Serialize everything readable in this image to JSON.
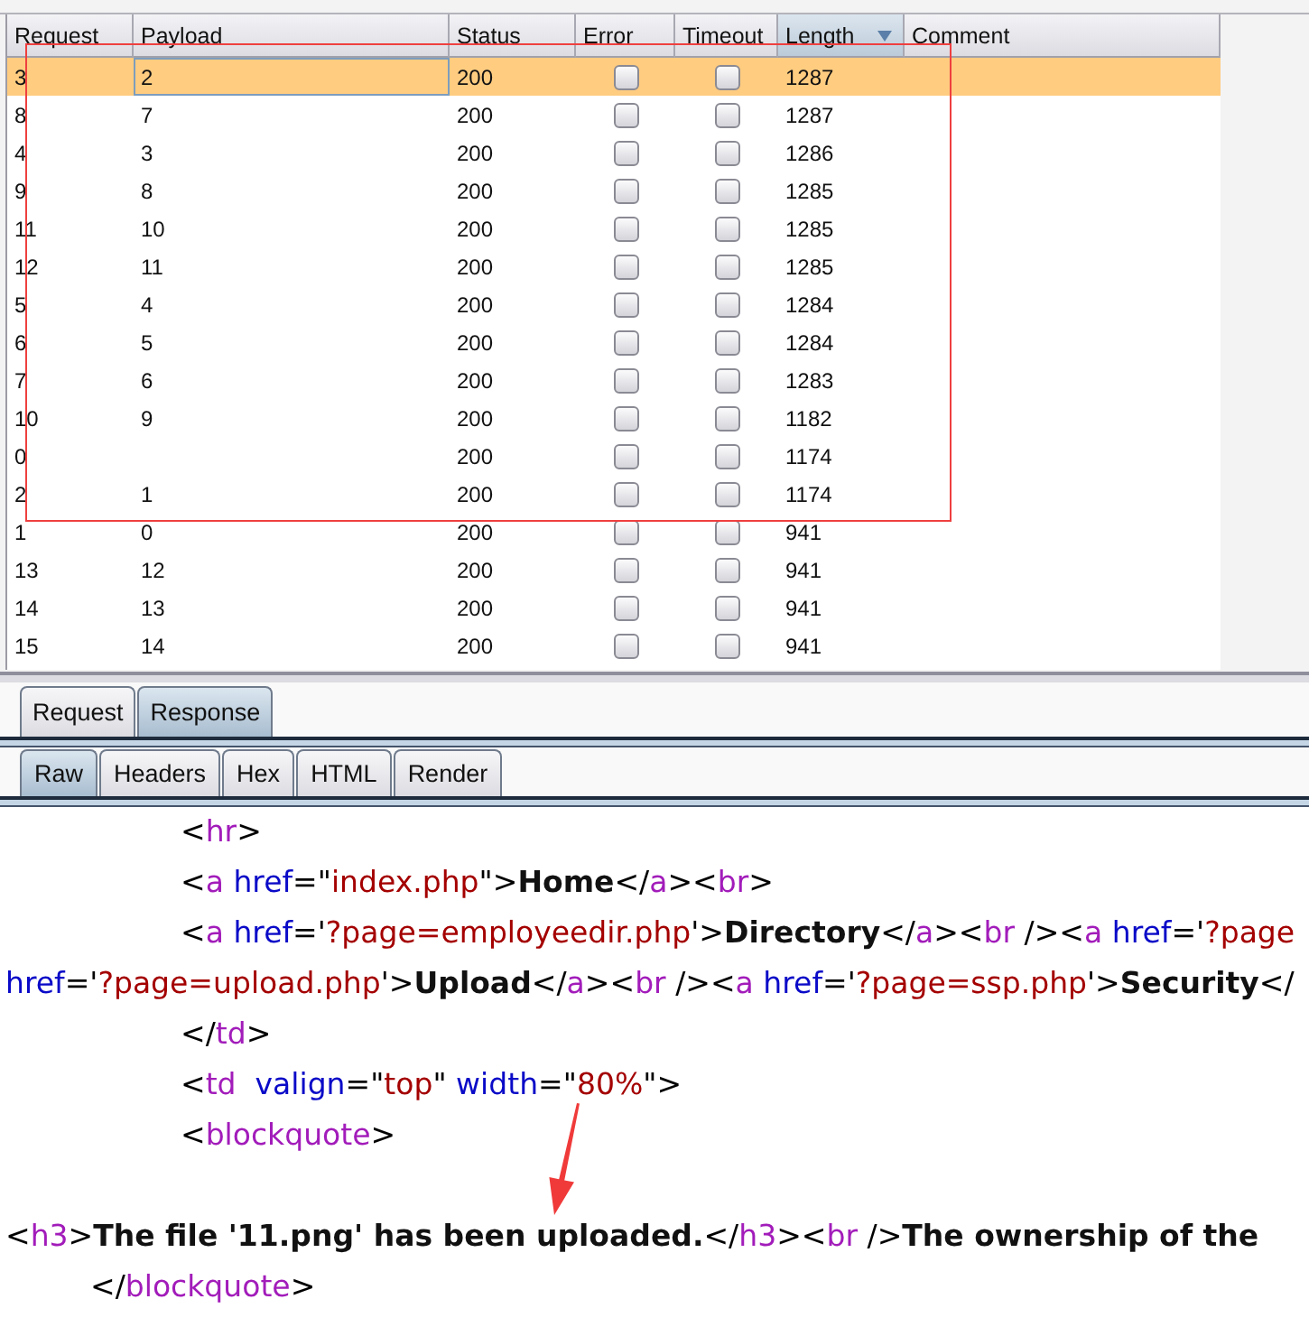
{
  "results_table": {
    "columns": [
      {
        "label": "Request",
        "sorted": false
      },
      {
        "label": "Payload",
        "sorted": false
      },
      {
        "label": "Status",
        "sorted": false
      },
      {
        "label": "Error",
        "sorted": false
      },
      {
        "label": "Timeout",
        "sorted": false
      },
      {
        "label": "Length",
        "sorted": true
      },
      {
        "label": "Comment",
        "sorted": false
      }
    ],
    "rows": [
      {
        "request": "3",
        "payload": "2",
        "status": "200",
        "error": false,
        "timeout": false,
        "length": "1287",
        "selected": true
      },
      {
        "request": "8",
        "payload": "7",
        "status": "200",
        "error": false,
        "timeout": false,
        "length": "1287",
        "selected": false
      },
      {
        "request": "4",
        "payload": "3",
        "status": "200",
        "error": false,
        "timeout": false,
        "length": "1286",
        "selected": false
      },
      {
        "request": "9",
        "payload": "8",
        "status": "200",
        "error": false,
        "timeout": false,
        "length": "1285",
        "selected": false
      },
      {
        "request": "11",
        "payload": "10",
        "status": "200",
        "error": false,
        "timeout": false,
        "length": "1285",
        "selected": false
      },
      {
        "request": "12",
        "payload": "11",
        "status": "200",
        "error": false,
        "timeout": false,
        "length": "1285",
        "selected": false
      },
      {
        "request": "5",
        "payload": "4",
        "status": "200",
        "error": false,
        "timeout": false,
        "length": "1284",
        "selected": false
      },
      {
        "request": "6",
        "payload": "5",
        "status": "200",
        "error": false,
        "timeout": false,
        "length": "1284",
        "selected": false
      },
      {
        "request": "7",
        "payload": "6",
        "status": "200",
        "error": false,
        "timeout": false,
        "length": "1283",
        "selected": false
      },
      {
        "request": "10",
        "payload": "9",
        "status": "200",
        "error": false,
        "timeout": false,
        "length": "1182",
        "selected": false
      },
      {
        "request": "0",
        "status": "200",
        "error": false,
        "timeout": false,
        "length": "1174",
        "selected": false
      },
      {
        "request": "2",
        "payload": "1",
        "status": "200",
        "error": false,
        "timeout": false,
        "length": "1174",
        "selected": false
      },
      {
        "request": "1",
        "payload": "0",
        "status": "200",
        "error": false,
        "timeout": false,
        "length": "941",
        "selected": false
      },
      {
        "request": "13",
        "payload": "12",
        "status": "200",
        "error": false,
        "timeout": false,
        "length": "941",
        "selected": false
      },
      {
        "request": "14",
        "payload": "13",
        "status": "200",
        "error": false,
        "timeout": false,
        "length": "941",
        "selected": false
      },
      {
        "request": "15",
        "payload": "14",
        "status": "200",
        "error": false,
        "timeout": false,
        "length": "941",
        "selected": false
      }
    ]
  },
  "message_tabs": [
    {
      "label": "Request",
      "selected": false
    },
    {
      "label": "Response",
      "selected": true
    }
  ],
  "view_tabs": [
    {
      "label": "Raw",
      "selected": true
    },
    {
      "label": "Headers",
      "selected": false
    },
    {
      "label": "Hex",
      "selected": false
    },
    {
      "label": "HTML",
      "selected": false
    },
    {
      "label": "Render",
      "selected": false
    }
  ],
  "response_body": {
    "lines": [
      {
        "kind": "inner",
        "tokens": [
          {
            "kind": "punct",
            "text": "<"
          },
          {
            "kind": "tag",
            "text": "hr"
          },
          {
            "kind": "punct",
            "text": ">"
          }
        ]
      },
      {
        "kind": "inner",
        "tokens": [
          {
            "kind": "punct",
            "text": "<"
          },
          {
            "kind": "tag",
            "text": "a"
          },
          {
            "kind": "attr",
            "text": " href"
          },
          {
            "kind": "punct",
            "text": "=\""
          },
          {
            "kind": "value",
            "text": "index.php"
          },
          {
            "kind": "punct",
            "text": "\">"
          },
          {
            "kind": "text",
            "text": "Home"
          },
          {
            "kind": "punct",
            "text": "</"
          },
          {
            "kind": "tag",
            "text": "a"
          },
          {
            "kind": "punct",
            "text": "><"
          },
          {
            "kind": "tag",
            "text": "br"
          },
          {
            "kind": "punct",
            "text": ">"
          }
        ]
      },
      {
        "kind": "inner",
        "tokens": [
          {
            "kind": "punct",
            "text": "<"
          },
          {
            "kind": "tag",
            "text": "a"
          },
          {
            "kind": "attr",
            "text": " href"
          },
          {
            "kind": "punct",
            "text": "='"
          },
          {
            "kind": "value",
            "text": "?page=employeedir.php"
          },
          {
            "kind": "punct",
            "text": "'>"
          },
          {
            "kind": "text",
            "text": "Directory"
          },
          {
            "kind": "punct",
            "text": "</"
          },
          {
            "kind": "tag",
            "text": "a"
          },
          {
            "kind": "punct",
            "text": "><"
          },
          {
            "kind": "tag",
            "text": "br"
          },
          {
            "kind": "punct",
            "text": " /><"
          },
          {
            "kind": "tag",
            "text": "a"
          },
          {
            "kind": "attr",
            "text": " href"
          },
          {
            "kind": "punct",
            "text": "='"
          },
          {
            "kind": "value",
            "text": "?page"
          }
        ]
      },
      {
        "kind": "flush",
        "tokens": [
          {
            "kind": "attr",
            "text": "href"
          },
          {
            "kind": "punct",
            "text": "='"
          },
          {
            "kind": "value",
            "text": "?page=upload.php"
          },
          {
            "kind": "punct",
            "text": "'>"
          },
          {
            "kind": "text",
            "text": "Upload"
          },
          {
            "kind": "punct",
            "text": "</"
          },
          {
            "kind": "tag",
            "text": "a"
          },
          {
            "kind": "punct",
            "text": "><"
          },
          {
            "kind": "tag",
            "text": "br"
          },
          {
            "kind": "punct",
            "text": " /><"
          },
          {
            "kind": "tag",
            "text": "a"
          },
          {
            "kind": "attr",
            "text": " href"
          },
          {
            "kind": "punct",
            "text": "='"
          },
          {
            "kind": "value",
            "text": "?page=ssp.php"
          },
          {
            "kind": "punct",
            "text": "'>"
          },
          {
            "kind": "text",
            "text": "Security"
          },
          {
            "kind": "punct",
            "text": "</"
          }
        ]
      },
      {
        "kind": "inner",
        "tokens": [
          {
            "kind": "punct",
            "text": "</"
          },
          {
            "kind": "tag",
            "text": "td"
          },
          {
            "kind": "punct",
            "text": ">"
          }
        ]
      },
      {
        "kind": "inner",
        "tokens": [
          {
            "kind": "punct",
            "text": "<"
          },
          {
            "kind": "tag",
            "text": "td"
          },
          {
            "kind": "attr",
            "text": "  valign"
          },
          {
            "kind": "punct",
            "text": "=\""
          },
          {
            "kind": "value",
            "text": "top"
          },
          {
            "kind": "punct",
            "text": "\""
          },
          {
            "kind": "attr",
            "text": " width"
          },
          {
            "kind": "punct",
            "text": "=\""
          },
          {
            "kind": "value",
            "text": "80%"
          },
          {
            "kind": "punct",
            "text": "\">"
          }
        ]
      },
      {
        "kind": "inner",
        "tokens": [
          {
            "kind": "punct",
            "text": "<"
          },
          {
            "kind": "tag",
            "text": "blockquote"
          },
          {
            "kind": "punct",
            "text": ">"
          }
        ]
      },
      {
        "kind": "blank"
      },
      {
        "kind": "flush",
        "tokens": [
          {
            "kind": "punct",
            "text": "<"
          },
          {
            "kind": "tag",
            "text": "h3"
          },
          {
            "kind": "punct",
            "text": ">"
          },
          {
            "kind": "text",
            "text": "The file '11.png' has been uploaded."
          },
          {
            "kind": "punct",
            "text": "</"
          },
          {
            "kind": "tag",
            "text": "h3"
          },
          {
            "kind": "punct",
            "text": "><"
          },
          {
            "kind": "tag",
            "text": "br"
          },
          {
            "kind": "punct",
            "text": " />"
          },
          {
            "kind": "text",
            "text": "The ownership of the"
          }
        ]
      },
      {
        "kind": "outer",
        "tokens": [
          {
            "kind": "punct",
            "text": "</"
          },
          {
            "kind": "tag",
            "text": "blockquote"
          },
          {
            "kind": "punct",
            "text": ">"
          }
        ]
      }
    ]
  },
  "annotations": [
    {
      "kind": "rectangle"
    },
    {
      "kind": "arrow"
    }
  ]
}
